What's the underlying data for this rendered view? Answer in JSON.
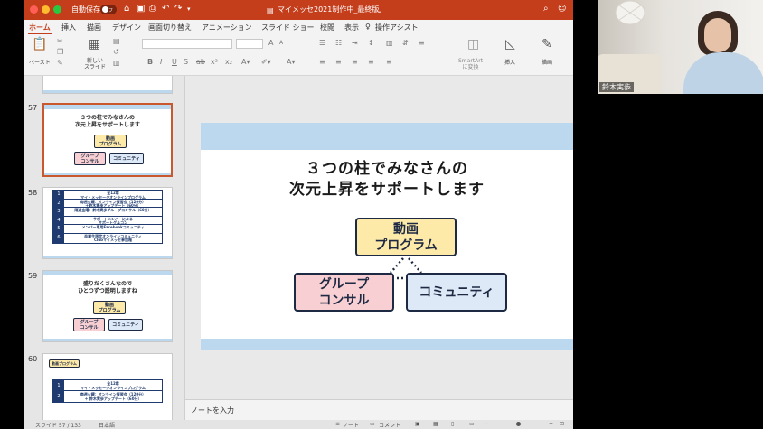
{
  "window": {
    "autosave_label": "自動保存",
    "autosave_state": "オフ",
    "doc_title": "マイメッセ2021制作中_最終版"
  },
  "menu": {
    "tabs": [
      "ホーム",
      "挿入",
      "描画",
      "デザイン",
      "画面切り替え",
      "アニメーション",
      "スライド ショー",
      "校閲",
      "表示"
    ],
    "assist": "操作アシスト",
    "share": "共有"
  },
  "ribbon": {
    "paste": "ペースト",
    "new_slide": "新しい\nスライド",
    "smartart": "SmartArt\nに変換",
    "insert": "挿入",
    "draw": "描画"
  },
  "thumbnails": {
    "slides": [
      {
        "number": "57",
        "title_l1": "３つの柱でみなさんの",
        "title_l2": "次元上昇をサポートします",
        "box_video": "動画\nプログラム",
        "box_group": "グループ\nコンサル",
        "box_community": "コミュニティ"
      },
      {
        "number": "58",
        "table_title": "全12章",
        "rows": [
          {
            "n": "1",
            "text": "全12章\nマイ・メッセージオンラインプログラム"
          },
          {
            "n": "2",
            "text": "毎週火曜：オンライン復習会（120分）\n＋鈴木実歩アップデート（60分）"
          },
          {
            "n": "3",
            "text": "隔週金曜：鈴木実歩グループコンサル（60分）"
          },
          {
            "n": "4",
            "text": "サポートメンバーによる\nサポートグルコン"
          },
          {
            "n": "5",
            "text": "メンバー専用Facebookコミュニティ"
          },
          {
            "n": "6",
            "text": "卒業生限定オンラインコミュニティ\nClubマイメッセ参加権"
          }
        ]
      },
      {
        "number": "59",
        "title_l1": "盛りだくさんなので",
        "title_l2": "ひとつずつ説明しますね",
        "box_video": "動画\nプログラム",
        "box_group": "グループ\nコンサル",
        "box_community": "コミュニティ"
      },
      {
        "number": "60",
        "tag": "動画プログラム",
        "rows": [
          {
            "n": "1",
            "text": "全12章\nマイ・メッセージオンラインプログラム"
          },
          {
            "n": "2",
            "text": "毎週火曜：オンライン復習会（120分）\n＋ 鈴木実歩アップデート（60分）"
          }
        ]
      }
    ]
  },
  "slide": {
    "title_line1": "３つの柱でみなさんの",
    "title_line2": "次元上昇をサポートします",
    "box_video": "動画\nプログラム",
    "box_group": "グループ\nコンサル",
    "box_community": "コミュニティ"
  },
  "notes": {
    "placeholder": "ノートを入力"
  },
  "status": {
    "slide_counter": "スライド 57 / 133",
    "language": "日本語",
    "notes_btn": "ノート",
    "comments_btn": "コメント"
  },
  "video": {
    "participant_name": "鈴木実歩"
  },
  "colors": {
    "accent": "#c43e1c",
    "band": "#bcd8ee",
    "box_yellow": "#fde9a8",
    "box_pink": "#f8d0d3",
    "box_blue": "#dde9f7",
    "box_border": "#1e2a44"
  }
}
